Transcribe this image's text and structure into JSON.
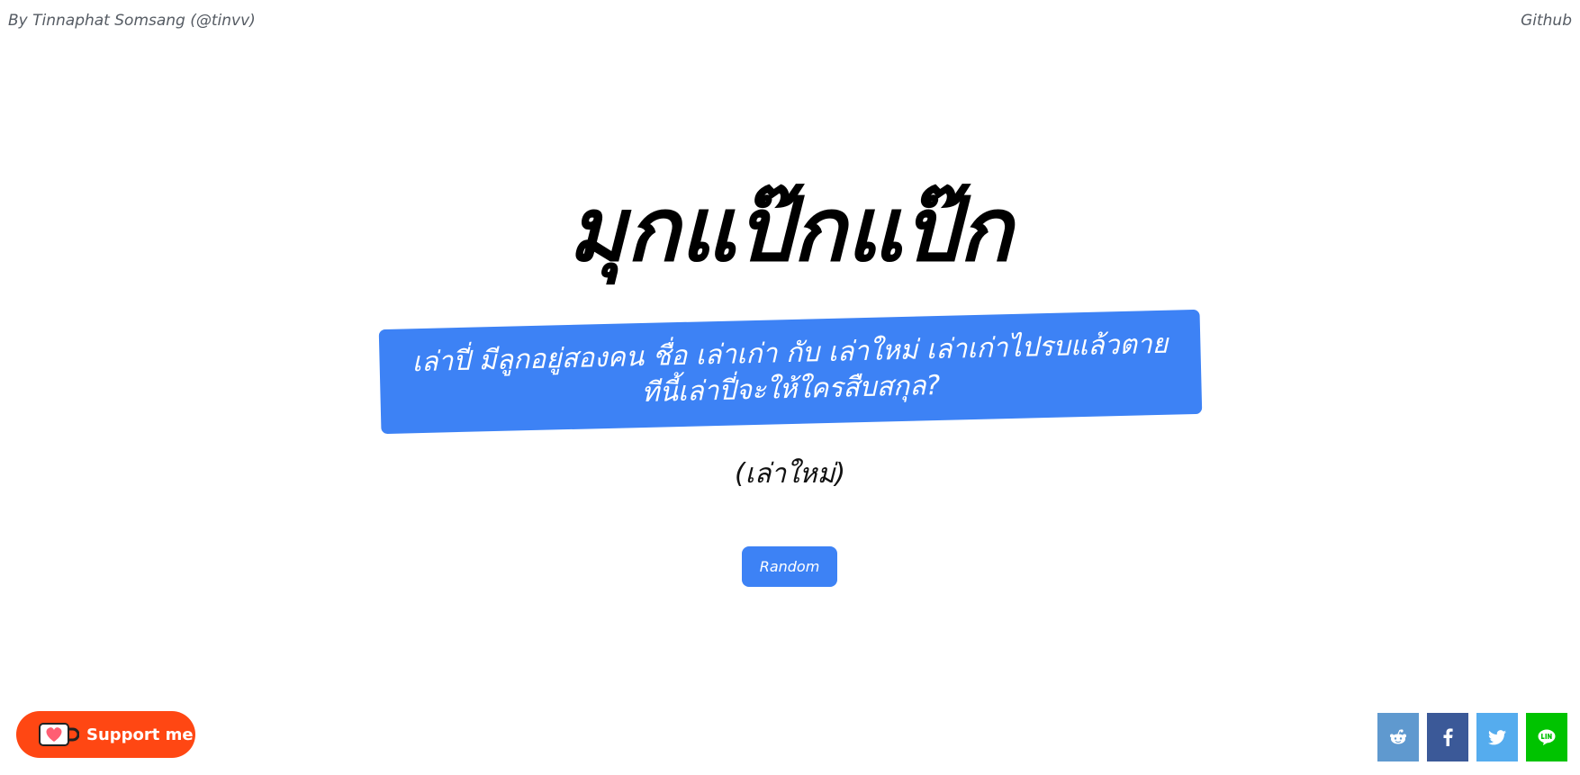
{
  "header": {
    "credit": "By Tinnaphat Somsang (@tinvv)",
    "github_label": "Github"
  },
  "main": {
    "title": "มุกแป๊กแป๊ก",
    "question_line1": "เล่าปี่ มีลูกอยู่สองคน ชื่อ เล่าเก่า กับ เล่าใหม่ เล่าเก่าไปรบแล้วตาย",
    "question_line2": "ทีนี้เล่าปี่จะให้ใครสืบสกุล?",
    "answer": "(เล่าใหม่)",
    "random_label": "Random"
  },
  "footer": {
    "support_label": "Support me",
    "share_icons": [
      "reddit-icon",
      "facebook-icon",
      "twitter-icon",
      "line-icon"
    ]
  },
  "colors": {
    "accent_blue": "#3d82f5",
    "support_orange": "#ff4713",
    "reddit": "#5f99cf",
    "facebook": "#3b5998",
    "twitter": "#55acee",
    "line": "#00c300"
  }
}
